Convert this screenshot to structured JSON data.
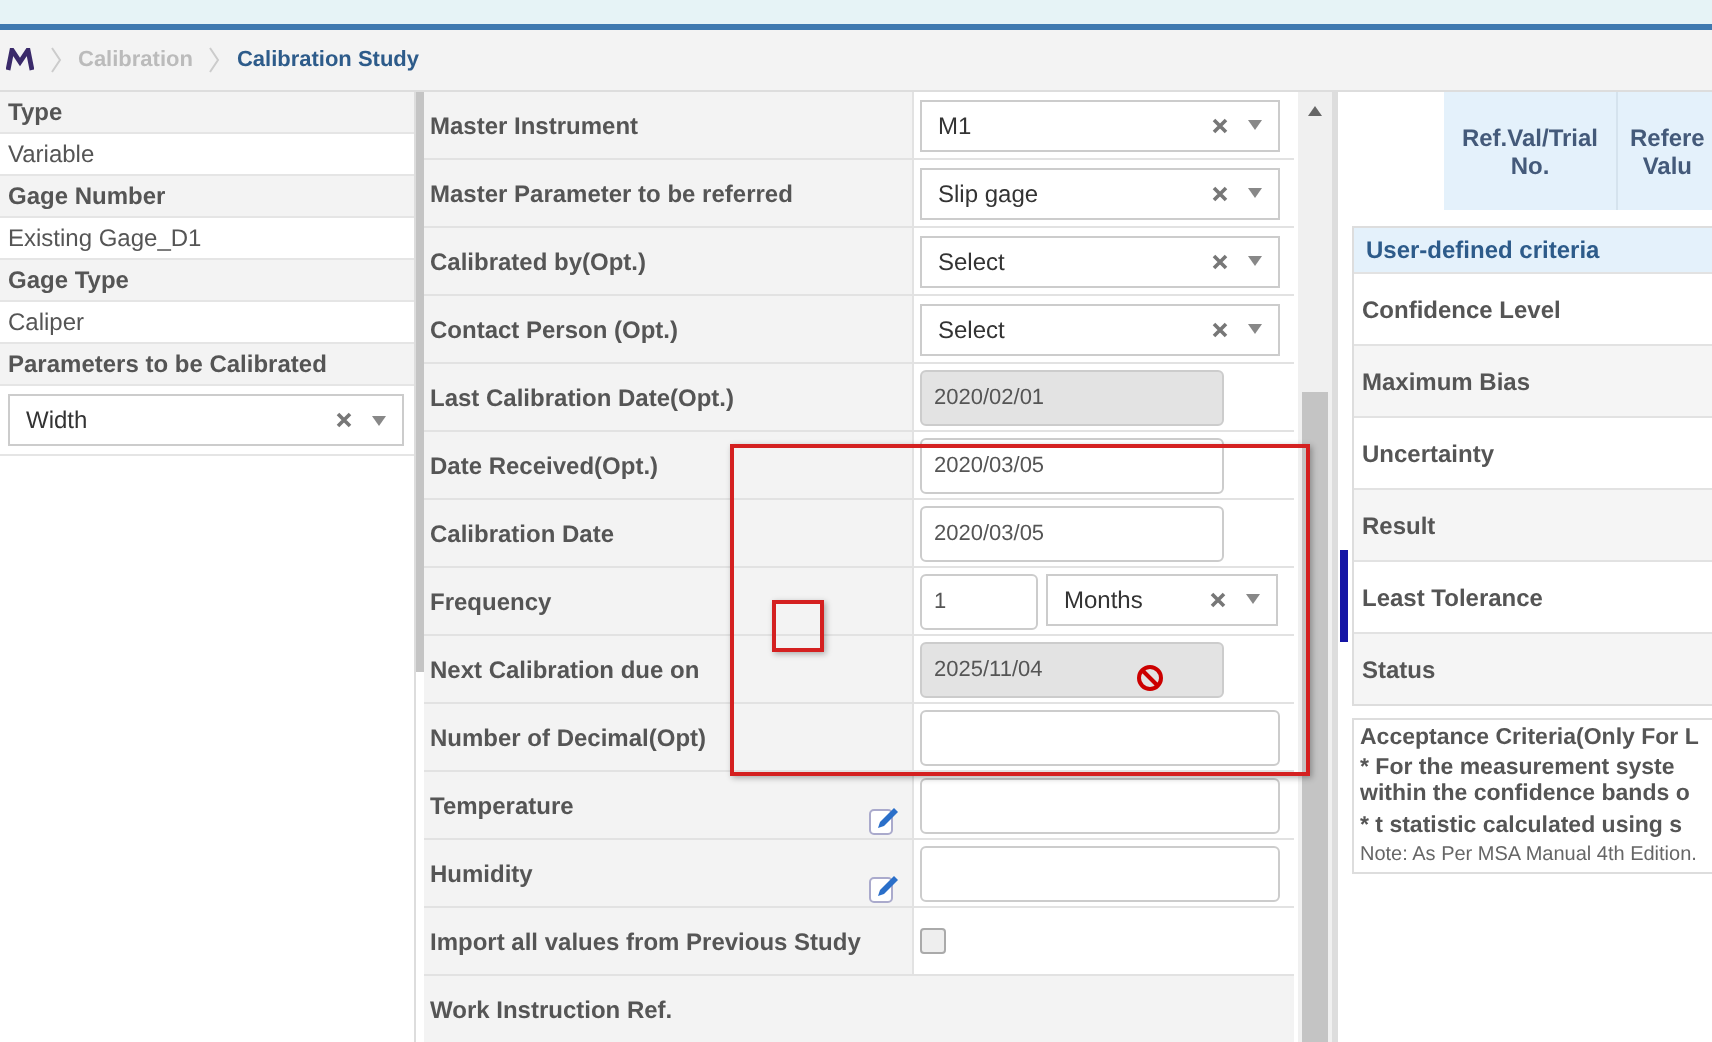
{
  "breadcrumb": [
    {
      "label": "Calibration",
      "selected": false
    },
    {
      "label": "Calibration Study",
      "selected": true
    }
  ],
  "details": [
    {
      "label": "Type",
      "value": "Variable"
    },
    {
      "label": "Gage Number",
      "value": "Existing Gage_D1"
    },
    {
      "label": "Gage Type",
      "value": "Caliper"
    }
  ],
  "parameters": {
    "label": "Parameters to be Calibrated",
    "value": "Width"
  },
  "form_rows": [
    {
      "label": "Master Instrument",
      "kind": "select",
      "value": "M1"
    },
    {
      "label": "Master Parameter to be referred",
      "kind": "select",
      "value": "Slip gage"
    },
    {
      "label": "Calibrated by(Opt.)",
      "kind": "select",
      "value": "Select"
    },
    {
      "label": "Contact Person (Opt.)",
      "kind": "select",
      "value": "Select"
    },
    {
      "label": "Last Calibration Date(Opt.)",
      "kind": "date",
      "value": "2020/02/01",
      "disabled": true
    },
    {
      "label": "Date Received(Opt.)",
      "kind": "date",
      "value": "2020/03/05",
      "disabled": false
    },
    {
      "label": "Calibration Date",
      "kind": "date",
      "value": "2020/03/05",
      "disabled": false
    },
    {
      "label": "Frequency",
      "kind": "frequency",
      "value": "1",
      "unit": "Months"
    },
    {
      "label": "Next Calibration due on",
      "kind": "date",
      "value": "2025/11/04",
      "disabled": true
    },
    {
      "label": "Number of Decimal(Opt)",
      "kind": "text",
      "editable": false
    },
    {
      "label": "Temperature",
      "kind": "text",
      "editable": true
    },
    {
      "label": "Humidity",
      "kind": "text",
      "editable": true
    },
    {
      "label": "Import all values from Previous Study",
      "kind": "checkbox",
      "checked": false
    },
    {
      "label": "Work Instruction Ref.",
      "kind": "heading"
    }
  ],
  "grid_headers": [
    {
      "lines": [
        "Ref.Val/Trial",
        "No."
      ]
    },
    {
      "lines": [
        "Refere",
        "Valu"
      ]
    }
  ],
  "criteria": {
    "title": "User-defined criteria",
    "rows": [
      {
        "label": "Confidence Level",
        "selected": false
      },
      {
        "label": "Maximum Bias",
        "selected": false
      },
      {
        "label": "Uncertainty",
        "selected": false
      },
      {
        "label": "Result",
        "selected": false
      },
      {
        "label": "Least Tolerance",
        "selected": true
      },
      {
        "label": "Status",
        "selected": false
      }
    ]
  },
  "acceptance": {
    "title": "Acceptance Criteria(Only For L",
    "lines": [
      "* For the measurement syste",
      "within the confidence bands o",
      "* t statistic calculated using s"
    ],
    "note": "Note: As Per MSA Manual 4th Edition."
  }
}
